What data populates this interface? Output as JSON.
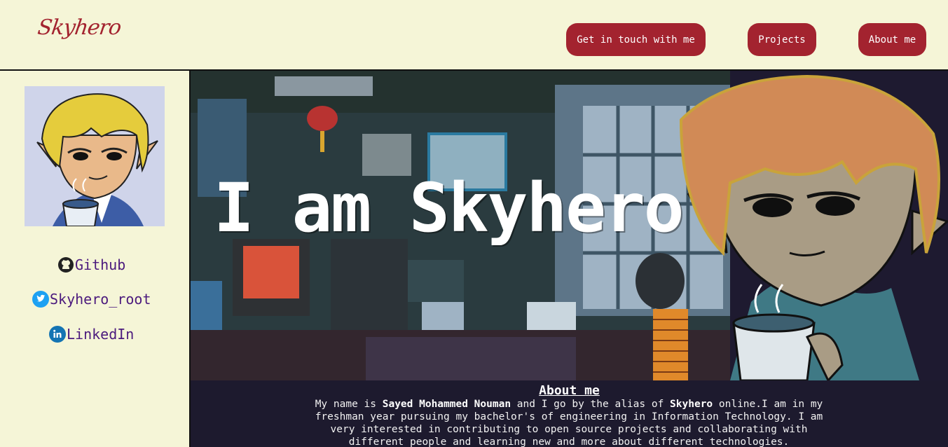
{
  "header": {
    "logo": "Skyhero",
    "nav": [
      {
        "label": "Get in touch with me"
      },
      {
        "label": "Projects"
      },
      {
        "label": "About me"
      }
    ]
  },
  "sidebar": {
    "links": [
      {
        "label": "Github",
        "icon": "github-icon"
      },
      {
        "label": "Skyhero_root",
        "icon": "twitter-icon"
      },
      {
        "label": "LinkedIn",
        "icon": "linkedin-icon"
      }
    ]
  },
  "hero": {
    "title": "I am Skyhero"
  },
  "about": {
    "title": "About me",
    "p1": "My name is ",
    "name": "Sayed Mohammed Nouman",
    "p2": " and I go by the alias of ",
    "alias": "Skyhero",
    "p3": " online.I am in my freshman year pursuing my bachelor's of engineering in Information Technology. I am very interested in contributing to open source projects and collaborating with different people and learning new and more about different technologies."
  },
  "colors": {
    "background": "#f5f5d7",
    "accent": "#a3232f",
    "link": "#4b1a7d",
    "main_bg": "#1d1a2e"
  }
}
